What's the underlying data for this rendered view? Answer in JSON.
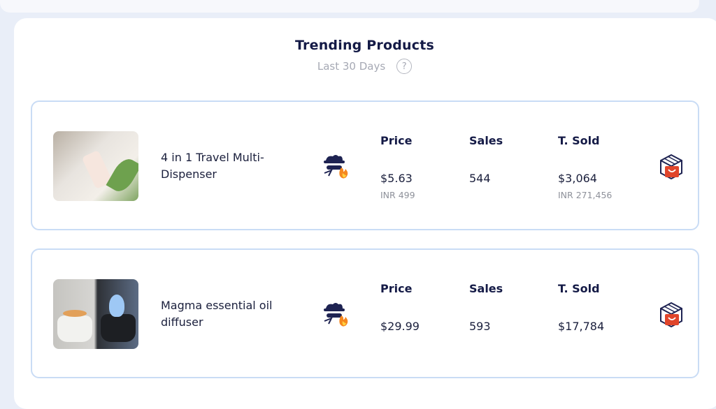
{
  "header": {
    "title": "Trending Products",
    "subtitle": "Last 30 Days",
    "help_icon": "question-circle-icon"
  },
  "columns": {
    "price": "Price",
    "sales": "Sales",
    "total_sold": "T. Sold"
  },
  "products": [
    {
      "name": "4 in 1 Travel Multi-Dispenser",
      "price": "$5.63",
      "price_local": "INR 499",
      "sales": "544",
      "total_sold": "$3,064",
      "total_sold_local": "INR 271,456"
    },
    {
      "name": "Magma essential oil diffuser",
      "price": "$29.99",
      "price_local": "",
      "sales": "593",
      "total_sold": "$17,784",
      "total_sold_local": ""
    }
  ],
  "icons": {
    "spy": "spy-fire-icon",
    "store": "shopping-bag-store-icon"
  },
  "colors": {
    "title": "#141a46",
    "card_border": "#c9dcf5",
    "muted": "#8e919a",
    "accent_red": "#e0452b"
  }
}
